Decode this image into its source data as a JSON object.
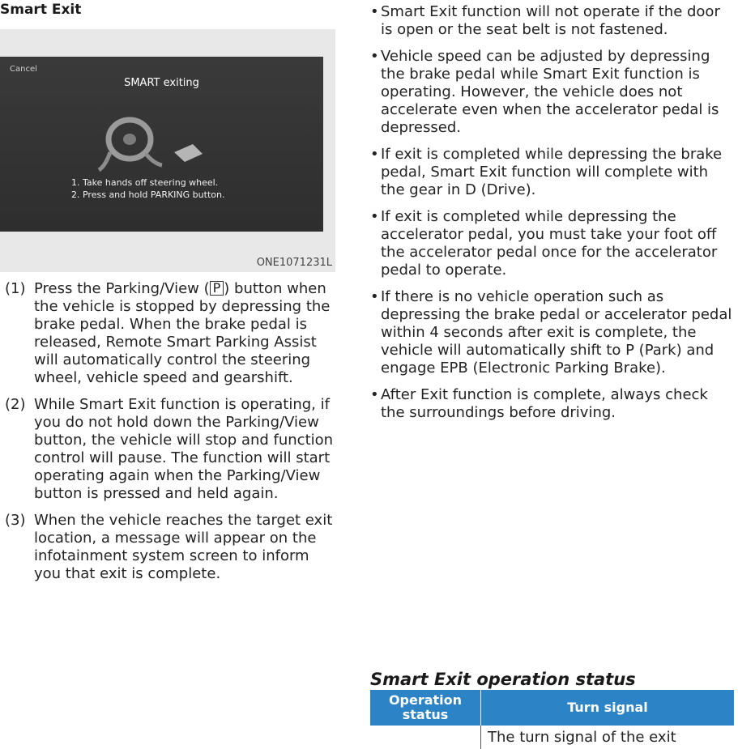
{
  "heading": "Smart Exit",
  "figure": {
    "cancel": "Cancel",
    "title": "SMART exiting",
    "steps": [
      "1. Take hands off steering wheel.",
      "2. Press and hold PARKING button."
    ],
    "code": "ONE1071231L"
  },
  "numbered": [
    {
      "num": "(1)",
      "pre": "Press the Parking/View (",
      "icon": "P",
      "post": ") button when the vehicle is stopped by depressing the brake pedal. When the brake pedal is released, Remote Smart Parking Assist will automatically control the steering wheel, vehicle speed and gearshift."
    },
    {
      "num": "(2)",
      "text": "While Smart Exit function is operating, if you do not hold down the Parking/View button, the vehicle will stop and function control will pause. The function will start operating again when the Parking/View button is pressed and held again."
    },
    {
      "num": "(3)",
      "text": "When the vehicle reaches the target exit location, a message will appear on the infotainment system screen to inform you that exit is complete."
    }
  ],
  "bullets": [
    "Smart Exit function will not operate if the door is open or the seat belt is not fastened.",
    "Vehicle speed can be adjusted by depressing the brake pedal while Smart Exit function is operating. However, the vehicle does not accelerate even when the accelerator pedal is depressed.",
    "If exit is completed while depressing the brake pedal, Smart Exit function will complete with the gear in D (Drive).",
    "If exit is completed while depressing the accelerator pedal, you must take your foot off the accelerator pedal once for the accelerator pedal to operate.",
    "If there is no vehicle operation such as depressing the brake pedal or accelerator pedal within 4 seconds after exit is complete, the vehicle will automatically shift to P (Park) and engage EPB (Electronic Parking Brake).",
    "After Exit function is complete, always check the surroundings before driving."
  ],
  "section_title": "Smart Exit operation status",
  "table": {
    "headers": [
      "Operation status",
      "Turn signal"
    ],
    "row1_cell2": "The turn signal of the exit"
  }
}
